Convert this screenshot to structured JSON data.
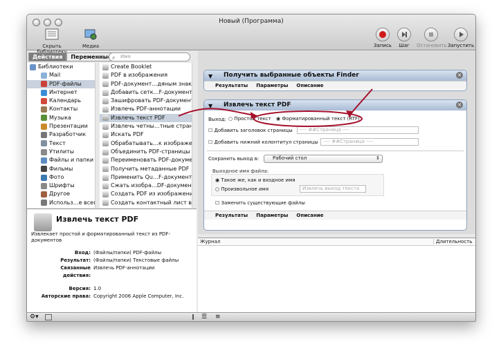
{
  "window": {
    "title": "Новый (Программа)"
  },
  "toolbar": {
    "hide_library": "Скрыть библиотеку",
    "media": "Медиа",
    "record": "Запись",
    "step": "Шаг",
    "stop": "Остановить",
    "run": "Запустить"
  },
  "library": {
    "tab_actions": "Действия",
    "tab_variables": "Переменные",
    "search_placeholder": "Имя",
    "categories": [
      "Библиотеки",
      "Mail",
      "PDF-файлы",
      "Интернет",
      "Календарь",
      "Контакты",
      "Музыка",
      "Презентации",
      "Разработчик",
      "Текст",
      "Утилиты",
      "Файлы и папки",
      "Фильмы",
      "Фото",
      "Шрифты",
      "Другое",
      "Использ…е всего"
    ],
    "actions": [
      "Create Booklet",
      "PDF в изображения",
      "PDF-документ…дяным знаком",
      "Добавить сетк…F-документам",
      "Зашифровать PDF-документы",
      "Извлечь PDF-аннотации",
      "Извлечь текст PDF",
      "Извлечь четны…тные страницы",
      "Искать PDF",
      "Обрабатывать…к изображения",
      "Объединить PDF-страницы",
      "Переименовать PDF-документы",
      "Получить метаданные PDF",
      "Применить Qu…F-документам",
      "Сжать изобра…DF-документах",
      "Создать PDF из изображений",
      "Создать контактный лист в PDF"
    ]
  },
  "description": {
    "title": "Извлечь текст PDF",
    "text": "Извлекает простой и форматированный текст из PDF-документов",
    "input_label": "Вход:",
    "input_value": "(Файлы/папки) PDF-файлы",
    "result_label": "Результат:",
    "result_value": "(Файлы/папки) Текстовые файлы",
    "related_label": "Связанные действия:",
    "related_value": "Извлечь PDF-аннотации",
    "version_label": "Версия:",
    "version_value": "1.0",
    "copyright_label": "Авторские права:",
    "copyright_value": "Copyright 2006 Apple Computer, Inc."
  },
  "workflow": {
    "action1": {
      "title": "Получить выбранные объекты Finder",
      "tab_results": "Результаты",
      "tab_params": "Параметры",
      "tab_desc": "Описание"
    },
    "action2": {
      "title": "Извлечь текст PDF",
      "output_label": "Выход:",
      "plain": "Простой текст",
      "rich": "Форматированный текст (RTF)",
      "add_header": "Добавить заголовок страницы",
      "header_ph": "---- ##Страница ----",
      "add_footer": "Добавить нижний колонтитул страницы",
      "footer_ph": "---- ##Страница ----",
      "save_to": "Сохранить выход в:",
      "folder": "Рабочий стол",
      "filename_label": "Выходное имя файла:",
      "same_name": "Такое же, как и входное имя",
      "custom_name": "Произвольное имя",
      "custom_ph": "Извлечь выход текста",
      "replace": "Заменить существующие файлы",
      "tab_results": "Результаты",
      "tab_params": "Параметры",
      "tab_desc": "Описание"
    }
  },
  "log": {
    "journal": "Журнал",
    "duration": "Длительность"
  },
  "colors": {
    "accent": "#a8bad3",
    "arrow": "#a5102a",
    "selection": "#c8d1dd"
  }
}
